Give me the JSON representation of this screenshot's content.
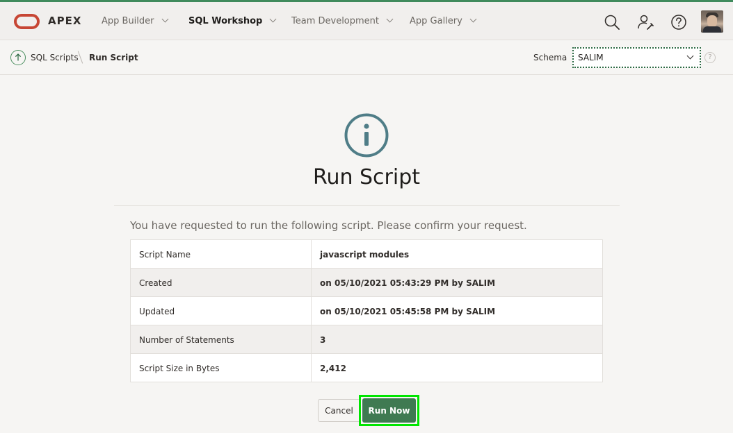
{
  "header": {
    "app_name": "APEX",
    "nav": [
      {
        "label": "App Builder",
        "active": false
      },
      {
        "label": "SQL Workshop",
        "active": true
      },
      {
        "label": "Team Development",
        "active": false
      },
      {
        "label": "App Gallery",
        "active": false
      }
    ],
    "icons": [
      "search-icon",
      "user-settings-icon",
      "help-icon",
      "avatar"
    ]
  },
  "breadcrumb": {
    "parent": "SQL Scripts",
    "current": "Run Script"
  },
  "schema": {
    "label": "Schema",
    "value": "SALIM",
    "help": "?"
  },
  "main": {
    "title": "Run Script",
    "message": "You have requested to run the following script. Please confirm your request.",
    "details": [
      {
        "label": "Script Name",
        "value": "javascript modules"
      },
      {
        "label": "Created",
        "value": "on 05/10/2021 05:43:29 PM by SALIM"
      },
      {
        "label": "Updated",
        "value": "on 05/10/2021 05:45:58 PM by SALIM"
      },
      {
        "label": "Number of Statements",
        "value": "3"
      },
      {
        "label": "Script Size in Bytes",
        "value": "2,412"
      }
    ],
    "buttons": {
      "cancel": "Cancel",
      "run": "Run Now"
    }
  },
  "colors": {
    "brand": "#c74634",
    "accent": "#3f7a52",
    "info_icon": "#4f7d87",
    "highlight": "#00e600"
  }
}
